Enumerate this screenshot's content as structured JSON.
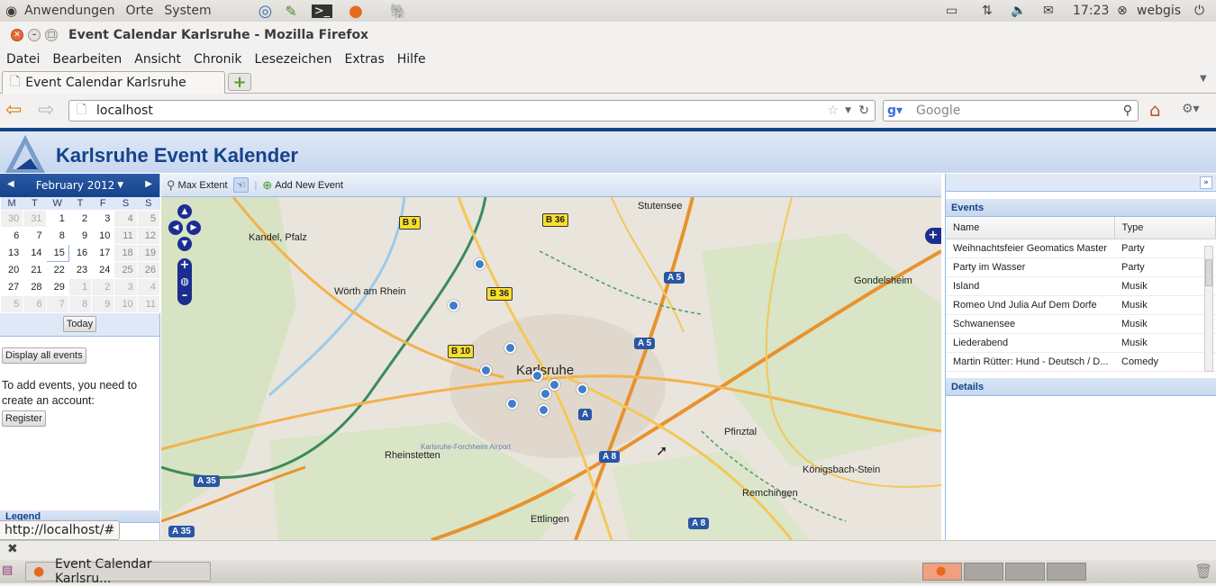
{
  "system_bar": {
    "apps": "Anwendungen",
    "places": "Orte",
    "system": "System",
    "time": "17:23",
    "user": "webgis"
  },
  "window": {
    "title": "Event Calendar Karlsruhe - Mozilla Firefox"
  },
  "menu": [
    "Datei",
    "Bearbeiten",
    "Ansicht",
    "Chronik",
    "Lesezeichen",
    "Extras",
    "Hilfe"
  ],
  "tab": {
    "label": "Event Calendar Karlsruhe"
  },
  "nav": {
    "url": "localhost",
    "search_placeholder": "Google"
  },
  "app": {
    "title": "Karlsruhe Event Kalender"
  },
  "calendar": {
    "month": "February 2012",
    "weekdays": [
      "M",
      "T",
      "W",
      "T",
      "F",
      "S",
      "S"
    ],
    "weeks": [
      [
        "30",
        "31",
        "1",
        "2",
        "3",
        "4",
        "5"
      ],
      [
        "6",
        "7",
        "8",
        "9",
        "10",
        "11",
        "12"
      ],
      [
        "13",
        "14",
        "15",
        "16",
        "17",
        "18",
        "19"
      ],
      [
        "20",
        "21",
        "22",
        "23",
        "24",
        "25",
        "26"
      ],
      [
        "27",
        "28",
        "29",
        "1",
        "2",
        "3",
        "4"
      ],
      [
        "5",
        "6",
        "7",
        "8",
        "9",
        "10",
        "11"
      ]
    ],
    "today_label": "Today"
  },
  "sidebar": {
    "display_all": "Display all events",
    "info_text": "To add events, you need to create an account:",
    "register": "Register",
    "legend": "Legend"
  },
  "map_toolbar": {
    "max_extent": "Max Extent",
    "add_event": "Add New Event"
  },
  "map_labels": {
    "kandel": "Kandel, Pfalz",
    "woerth": "Wörth am Rhein",
    "stutensee": "Stutensee",
    "gondelsheim": "Gondelsheim",
    "karlsruhe": "Karlsruhe",
    "rheinstetten": "Rheinstetten",
    "pfinztal": "Pfinztal",
    "koenigsbach": "Königsbach-Stein",
    "remchingen": "Remchingen",
    "ettlingen": "Ettlingen",
    "airport": "Karlsruhe-Forchheim Airport",
    "b9": "B 9",
    "b36a": "B 36",
    "b36b": "B 36",
    "b10": "B 10",
    "a5a": "A 5",
    "a5b": "A 5",
    "a8a": "A 8",
    "a8b": "A 8",
    "a35a": "A 35",
    "a35b": "A 35",
    "a": "A"
  },
  "events_panel": {
    "title": "Events",
    "columns": [
      "Name",
      "Type"
    ],
    "rows": [
      {
        "name": "Weihnachtsfeier Geomatics Master",
        "type": "Party"
      },
      {
        "name": "Party im Wasser",
        "type": "Party"
      },
      {
        "name": "Island",
        "type": "Musik"
      },
      {
        "name": "Romeo Und Julia Auf Dem Dorfe",
        "type": "Musik"
      },
      {
        "name": "Schwanensee",
        "type": "Musik"
      },
      {
        "name": "Liederabend",
        "type": "Musik"
      },
      {
        "name": "Martin Rütter: Hund - Deutsch / D...",
        "type": "Comedy"
      }
    ]
  },
  "details_panel": {
    "title": "Details"
  },
  "status": {
    "url": "http://localhost/#"
  },
  "taskbar": {
    "item": "Event Calendar Karlsru..."
  }
}
